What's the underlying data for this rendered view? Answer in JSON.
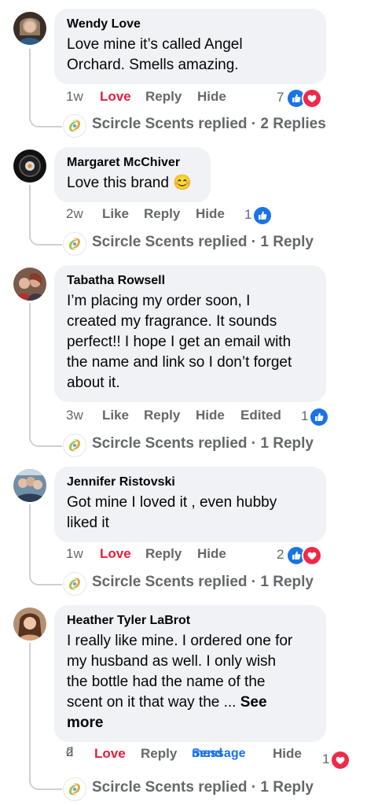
{
  "comments": [
    {
      "author": "Wendy Love",
      "text_lines": [
        "Love mine it’s called Angel",
        "Orchard. Smells amazing."
      ],
      "time": "1w",
      "reaction_label": "Love",
      "reply_label": "Reply",
      "hide_label": "Hide",
      "reaction_count": "7",
      "reaction_icons": [
        "like-icon",
        "heart-icon"
      ],
      "reply_summary": "Scircle Scents replied · 2 Replies"
    },
    {
      "author": "Margaret McChiver",
      "text_lines": [
        "Love this brand 😊"
      ],
      "time": "2w",
      "reaction_label": "Like",
      "reply_label": "Reply",
      "hide_label": "Hide",
      "reaction_count": "1",
      "reaction_icons": [
        "like-icon"
      ],
      "reply_summary": "Scircle Scents replied · 1 Reply"
    },
    {
      "author": "Tabatha Rowsell",
      "text_lines": [
        "I’m placing my order soon, I",
        "created my fragrance. It sounds",
        "perfect!! I hope I get an email with",
        "the name and link so I don’t forget",
        "about it."
      ],
      "time": "3w",
      "reaction_label": "Like",
      "reply_label": "Reply",
      "hide_label": "Hide",
      "edited_label": "Edited",
      "reaction_count": "1",
      "reaction_icons": [
        "like-icon"
      ],
      "reply_summary": "Scircle Scents replied · 1 Reply"
    },
    {
      "author": "Jennifer Ristovski",
      "text_lines": [
        "Got mine I loved it , even hubby",
        "liked it"
      ],
      "time": "1w",
      "reaction_label": "Love",
      "reply_label": "Reply",
      "hide_label": "Hide",
      "reaction_count": "2",
      "reaction_icons": [
        "like-icon",
        "heart-icon"
      ],
      "reply_summary": "Scircle Scents replied · 1 Reply"
    },
    {
      "author": "Heather Tyler LaBrot",
      "text_lines": [
        "I really like mine. I ordered one for",
        "my husband as well. I only wish",
        "the bottle had the name of the",
        "scent on it that way the ... "
      ],
      "see_more_line1": "See",
      "see_more_line2": "more",
      "time_line1": "2",
      "time_line2": "d",
      "reaction_label": "Love",
      "reply_label": "Reply",
      "send_message_line1": "Send",
      "send_message_line2": "message",
      "hide_label": "Hide",
      "reaction_count": "1",
      "reaction_icons": [
        "heart-icon"
      ],
      "reply_summary": "Scircle Scents replied · 1 Reply"
    }
  ],
  "colors": {
    "bubble": "#f0f2f5",
    "love": "#e41e3f",
    "link": "#1b74e4",
    "meta": "#65676b"
  }
}
